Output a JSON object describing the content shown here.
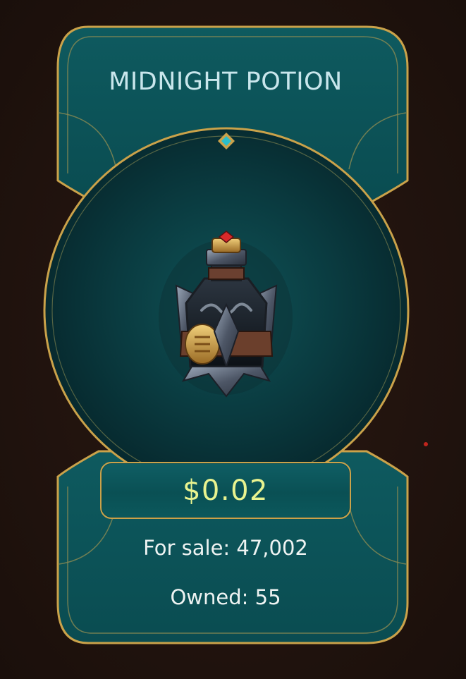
{
  "item": {
    "name": "MIDNIGHT POTION",
    "price": "$0.02",
    "for_sale": "For sale: 47,002",
    "owned": "Owned: 55",
    "image_icon": "potion-bottle-icon"
  },
  "colors": {
    "background": "#23140f",
    "panel": "#0d5257",
    "gold_border": "#caa24a",
    "price_text": "#e9f38f",
    "title_text": "#c9e6ec",
    "body_text": "#eef3f2"
  }
}
